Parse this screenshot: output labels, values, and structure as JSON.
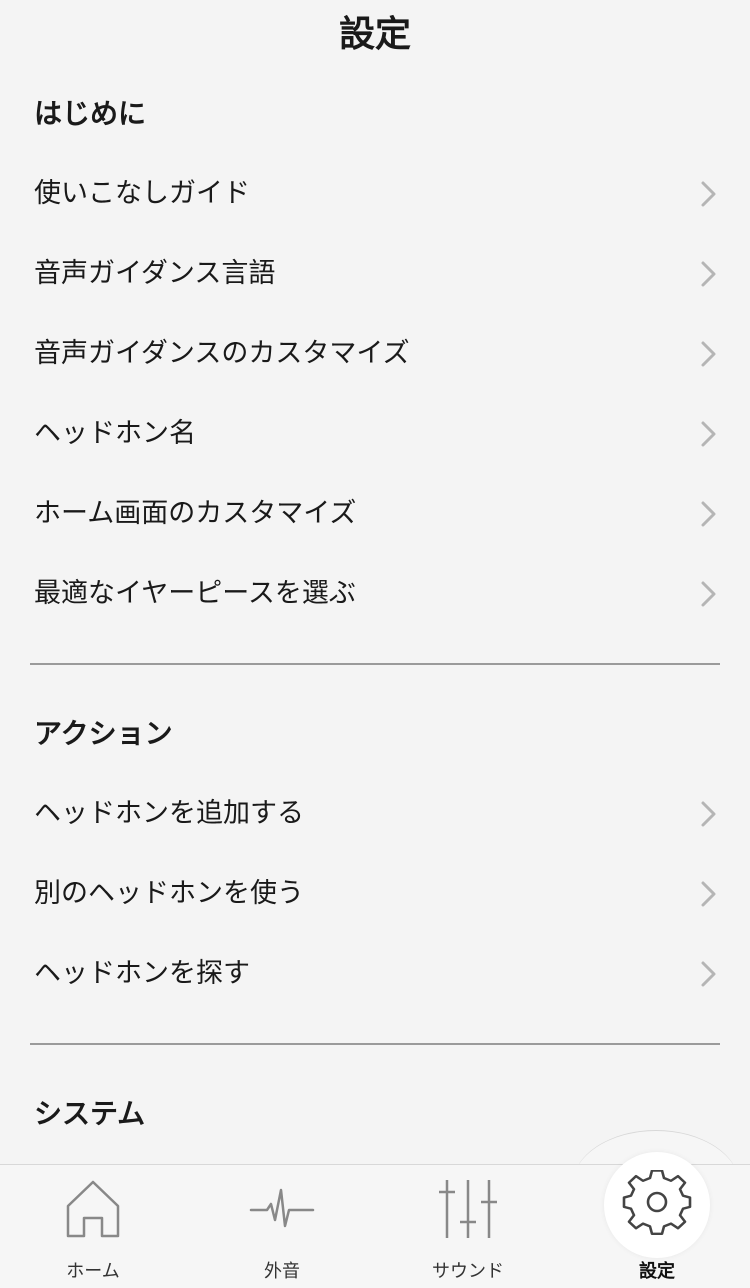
{
  "header": {
    "title": "設定"
  },
  "sections": [
    {
      "title": "はじめに",
      "items": [
        "使いこなしガイド",
        "音声ガイダンス言語",
        "音声ガイダンスのカスタマイズ",
        "ヘッドホン名",
        "ホーム画面のカスタマイズ",
        "最適なイヤーピースを選ぶ"
      ]
    },
    {
      "title": "アクション",
      "items": [
        "ヘッドホンを追加する",
        "別のヘッドホンを使う",
        "ヘッドホンを探す"
      ]
    },
    {
      "title": "システム",
      "items": []
    }
  ],
  "tabbar": {
    "tabs": [
      {
        "label": "ホーム",
        "icon": "home-icon"
      },
      {
        "label": "外音",
        "icon": "ambient-sound-icon"
      },
      {
        "label": "サウンド",
        "icon": "equalizer-icon"
      },
      {
        "label": "設定",
        "icon": "gear-icon"
      }
    ],
    "active_index": 3
  },
  "colors": {
    "background": "#f4f4f4",
    "text": "#1a1a1a",
    "chevron": "#b5b5b5",
    "divider": "#9a9a9a",
    "tab_icon": "#888888"
  }
}
